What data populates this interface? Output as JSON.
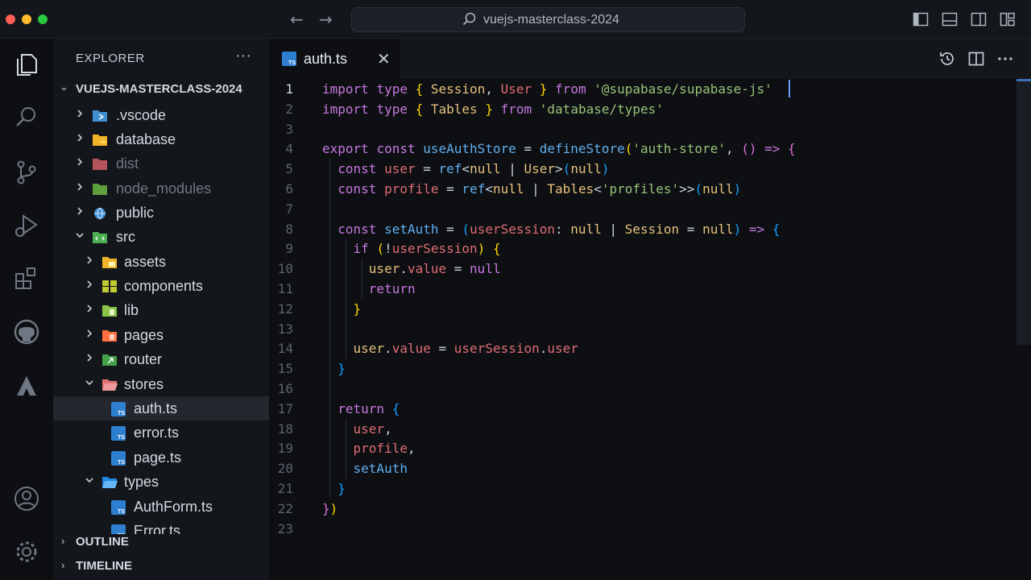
{
  "titlebar": {
    "search_text": "vuejs-masterclass-2024",
    "traffic_colors": [
      "#ff5f57",
      "#febc2e",
      "#28c840"
    ]
  },
  "activity": {
    "icons": [
      "explorer-icon",
      "search-icon",
      "source-control-icon",
      "run-debug-icon",
      "extensions-icon",
      "github-icon",
      "deploy-icon",
      "account-icon",
      "settings-gear-icon"
    ]
  },
  "sidebar": {
    "header": "EXPLORER",
    "more": "···",
    "project": "VUEJS-MASTERCLASS-2024",
    "items": [
      {
        "label": ".vscode"
      },
      {
        "label": "database"
      },
      {
        "label": "dist"
      },
      {
        "label": "node_modules"
      },
      {
        "label": "public"
      },
      {
        "label": "src"
      },
      {
        "label": "assets"
      },
      {
        "label": "components"
      },
      {
        "label": "lib"
      },
      {
        "label": "pages"
      },
      {
        "label": "router"
      },
      {
        "label": "stores"
      },
      {
        "label": "auth.ts"
      },
      {
        "label": "error.ts"
      },
      {
        "label": "page.ts"
      },
      {
        "label": "types"
      },
      {
        "label": "AuthForm.ts"
      },
      {
        "label": "Error.ts"
      }
    ],
    "outline": "OUTLINE",
    "timeline": "TIMELINE"
  },
  "editor": {
    "tab_label": "auth.ts",
    "tab_badge": "TS",
    "close_glyph": "✕",
    "line_numbers": [
      "1",
      "2",
      "3",
      "4",
      "5",
      "6",
      "7",
      "8",
      "9",
      "10",
      "11",
      "12",
      "13",
      "14",
      "15",
      "16",
      "17",
      "18",
      "19",
      "20",
      "21",
      "22",
      "23"
    ],
    "current_line": "1"
  },
  "colors": {
    "accent": "#2f7fd1",
    "keyword": "#c678dd",
    "string": "#98c379",
    "function": "#61afef"
  }
}
